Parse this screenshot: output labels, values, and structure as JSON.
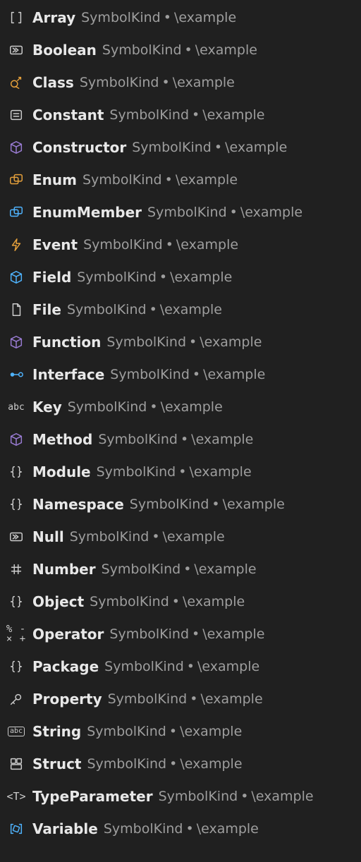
{
  "meta": {
    "kind_label": "SymbolKind",
    "separator": "•",
    "path": "\\example"
  },
  "colors": {
    "default": "#cccccc",
    "class": "#e5a03b",
    "enum": "#e5a03b",
    "event": "#e5a03b",
    "constructor": "#9a7cd4",
    "function": "#9a7cd4",
    "method": "#9a7cd4",
    "field": "#4fb4ff",
    "interface": "#4fb4ff",
    "enummember": "#4fb4ff",
    "variable": "#4fb4ff"
  },
  "items": [
    {
      "name": "Array",
      "icon": "array"
    },
    {
      "name": "Boolean",
      "icon": "boolean"
    },
    {
      "name": "Class",
      "icon": "class"
    },
    {
      "name": "Constant",
      "icon": "constant"
    },
    {
      "name": "Constructor",
      "icon": "constructor"
    },
    {
      "name": "Enum",
      "icon": "enum"
    },
    {
      "name": "EnumMember",
      "icon": "enummember"
    },
    {
      "name": "Event",
      "icon": "event"
    },
    {
      "name": "Field",
      "icon": "field"
    },
    {
      "name": "File",
      "icon": "file"
    },
    {
      "name": "Function",
      "icon": "function"
    },
    {
      "name": "Interface",
      "icon": "interface"
    },
    {
      "name": "Key",
      "icon": "key"
    },
    {
      "name": "Method",
      "icon": "method"
    },
    {
      "name": "Module",
      "icon": "module"
    },
    {
      "name": "Namespace",
      "icon": "namespace"
    },
    {
      "name": "Null",
      "icon": "null"
    },
    {
      "name": "Number",
      "icon": "number"
    },
    {
      "name": "Object",
      "icon": "object"
    },
    {
      "name": "Operator",
      "icon": "operator"
    },
    {
      "name": "Package",
      "icon": "package"
    },
    {
      "name": "Property",
      "icon": "property"
    },
    {
      "name": "String",
      "icon": "string"
    },
    {
      "name": "Struct",
      "icon": "struct"
    },
    {
      "name": "TypeParameter",
      "icon": "typeparameter"
    },
    {
      "name": "Variable",
      "icon": "variable"
    }
  ]
}
